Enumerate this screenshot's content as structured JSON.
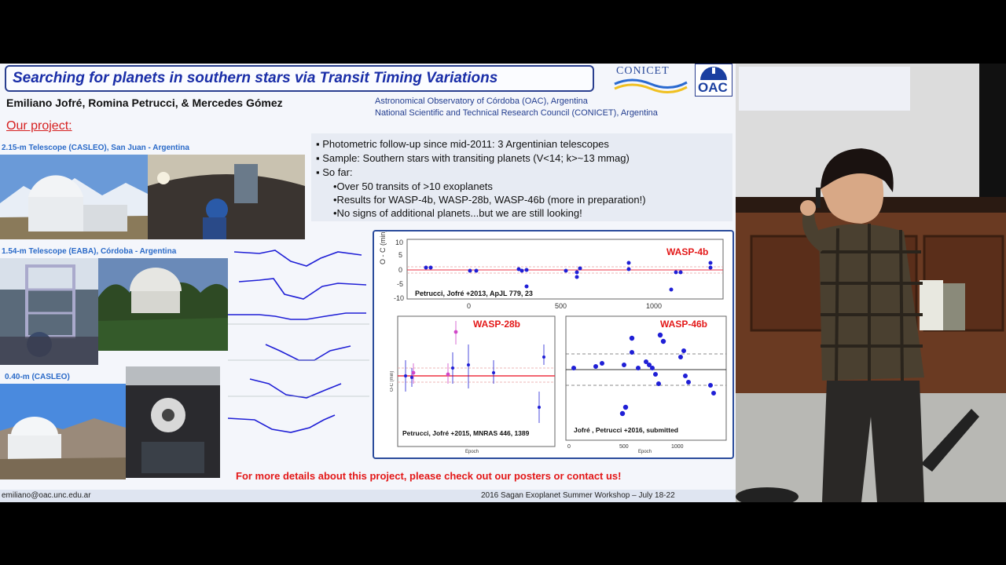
{
  "slide": {
    "title": "Searching for planets in southern stars via Transit Timing Variations",
    "logo_conicet": "CONICET",
    "logo_oac": "OAC",
    "authors": "Emiliano Jofré, Romina Petrucci, & Mercedes Gómez",
    "affiliation_1": "Astronomical Observatory of Córdoba (OAC), Argentina",
    "affiliation_2": "National Scientific and Technical Research Council (CONICET), Argentina",
    "section_heading": "Our project:",
    "telescope_1": "2.15-m Telescope (CASLEO), San Juan - Argentina",
    "telescope_2": "1.54-m Telescope (EABA), Córdoba - Argentina",
    "telescope_3": "0.40-m (CASLEO)",
    "bullets": [
      "▪ Photometric follow-up since mid-2011: 3 Argentinian telescopes",
      "▪ Sample: Southern stars with transiting planets (V<14; k>~13 mmag)",
      "▪ So far:",
      "•Over 50 transits of >10 exoplanets",
      "•Results for WASP-4b, WASP-28b, WASP-46b (more in  preparation!)",
      "•No signs of additional planets...but we are still looking!"
    ],
    "footer_message": "For more details about this project, please check out our posters or contact us!",
    "email": "emiliano@oac.unc.edu.ar",
    "workshop": "2016 Sagan Exoplanet Summer Workshop – July 18-22"
  },
  "plots": {
    "wasp4": {
      "label": "WASP-4b",
      "citation": "Petrucci, Jofré +2013, ApJL 779, 23",
      "y_ticks": [
        "10",
        "5",
        "0",
        "-5",
        "-10"
      ],
      "x_ticks": [
        "0",
        "500",
        "1000"
      ],
      "ylabel": "O - C (min)"
    },
    "wasp28": {
      "label": "WASP-28b",
      "citation": "Petrucci, Jofré +2015, MNRAS 446, 1389",
      "xlabel": "Epoch",
      "ylabel": "O-C (min)"
    },
    "wasp46": {
      "label": "WASP-46b",
      "citation": "Jofré , Petrucci +2016, submitted",
      "x_ticks": [
        "0",
        "500",
        "1000"
      ],
      "xlabel": "Epoch"
    }
  },
  "colors": {
    "title": "#1a2ea8",
    "accent_red": "#e31818",
    "data_blue": "#1f1fd6",
    "plot_border": "#2b4c9c"
  }
}
